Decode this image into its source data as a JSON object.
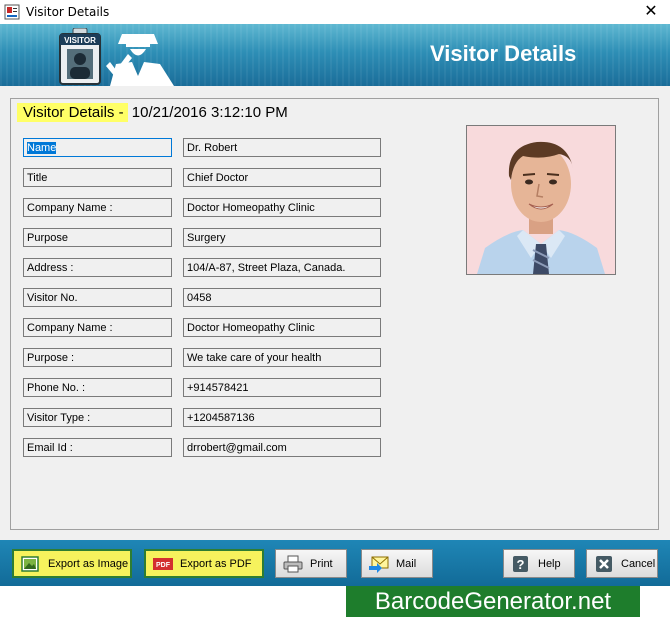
{
  "window": {
    "title": "Visitor Details",
    "close_glyph": "✕"
  },
  "banner": {
    "heading": "Visitor Details",
    "badge_text": "VISITOR"
  },
  "panel": {
    "title_label": "Visitor Details -",
    "timestamp": "10/21/2016 3:12:10 PM"
  },
  "fields": [
    {
      "label": "Name",
      "value": "Dr. Robert"
    },
    {
      "label": "Title",
      "value": "Chief Doctor"
    },
    {
      "label": "Company Name :",
      "value": "Doctor Homeopathy Clinic"
    },
    {
      "label": "Purpose",
      "value": "Surgery"
    },
    {
      "label": "Address :",
      "value": "104/A-87, Street Plaza, Canada."
    },
    {
      "label": "Visitor No.",
      "value": "0458"
    },
    {
      "label": "Company Name :",
      "value": "Doctor Homeopathy Clinic"
    },
    {
      "label": "Purpose :",
      "value": "We take care of your health"
    },
    {
      "label": "Phone No. :",
      "value": "+914578421"
    },
    {
      "label": "Visitor Type :",
      "value": "+1204587136"
    },
    {
      "label": "Email Id :",
      "value": "drrobert@gmail.com"
    }
  ],
  "buttons": {
    "export_image": "Export as Image",
    "export_pdf": "Export as PDF",
    "pdf_icon_text": "PDF",
    "print": "Print",
    "mail": "Mail",
    "help": "Help",
    "cancel": "Cancel"
  },
  "brand": "BarcodeGenerator.net",
  "colors": {
    "banner": "#2e8fb6",
    "highlight": "#ffff66",
    "export_button": "#f6f25d",
    "brand_bg": "#1e7d2c"
  }
}
